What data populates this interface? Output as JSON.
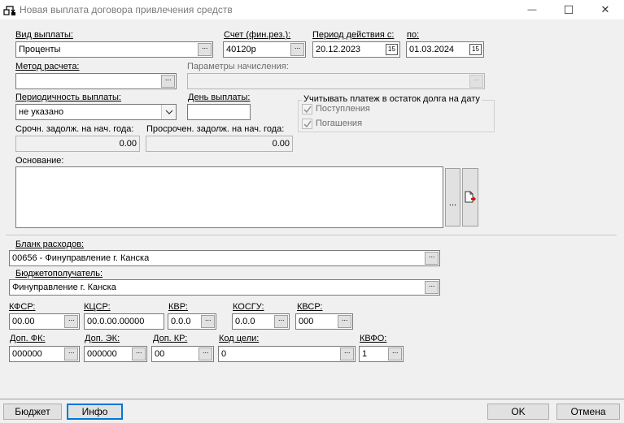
{
  "window": {
    "title": "Новая выплата договора привлечения средств",
    "minimize_glyph": "—",
    "maximize_glyph": "☐",
    "close_glyph": "✕"
  },
  "top_section": {
    "payment_type": {
      "label": "Вид выплаты:",
      "value": "Проценты"
    },
    "account": {
      "label": "Счет (фин.рез.):",
      "value": "40120р"
    },
    "period": {
      "label": "Период действия с:",
      "from": "20.12.2023",
      "to_label": "по:",
      "to": "01.03.2024"
    },
    "calc_method": {
      "label": "Метод расчета:",
      "value": ""
    },
    "accrual_params": {
      "label": "Параметры начисления:",
      "value": ""
    },
    "periodicity": {
      "label": "Периодичность выплаты:",
      "value": "не указано"
    },
    "payment_day": {
      "label": "День выплаты:",
      "value": ""
    },
    "consider_group": {
      "label": "Учитывать платеж в остаток долга на дату",
      "items": [
        {
          "label": "Поступления",
          "checked": true
        },
        {
          "label": "Погашения",
          "checked": true
        }
      ]
    },
    "urgent_debt": {
      "label": "Срочн. задолж. на нач. года:",
      "value": "0.00"
    },
    "overdue_debt": {
      "label": "Просрочен. задолж. на нач. года:",
      "value": "0.00"
    },
    "basis": {
      "label": "Основание:",
      "value": "",
      "ellipsis_button": "..."
    }
  },
  "bottom_section": {
    "expense_form": {
      "label": "Бланк расходов:",
      "value": "00656 - Финуправление г. Канска"
    },
    "recipient": {
      "label": "Бюджетополучатель:",
      "value": "Финуправление г. Канска"
    },
    "kfsr": {
      "label": "КФСР:",
      "value": "00.00"
    },
    "kcsr": {
      "label": "КЦСР:",
      "value": "00.0.00.00000"
    },
    "kvr": {
      "label": "КВР:",
      "value": "0.0.0"
    },
    "kosgu": {
      "label": "КОСГУ:",
      "value": "0.0.0"
    },
    "kvsr": {
      "label": "КВСР:",
      "value": "000"
    },
    "dop_fk": {
      "label": "Доп. ФК:",
      "value": "000000"
    },
    "dop_ek": {
      "label": "Доп. ЭК:",
      "value": "000000"
    },
    "dop_kr": {
      "label": "Доп. КР:",
      "value": "00"
    },
    "goal_code": {
      "label": "Код цели:",
      "value": "0"
    },
    "kvfo": {
      "label": "КВФО:",
      "value": "1"
    }
  },
  "buttons": {
    "budget": "Бюджет",
    "info": "Инфо",
    "ok": "OK",
    "cancel": "Отмена"
  },
  "ui": {
    "dots_glyph": "···",
    "calendar_glyph": "15"
  },
  "colors": {
    "window_bg": "#f0f0f0",
    "focus_border": "#0078d7",
    "disabled_text": "#6d6d6d"
  }
}
